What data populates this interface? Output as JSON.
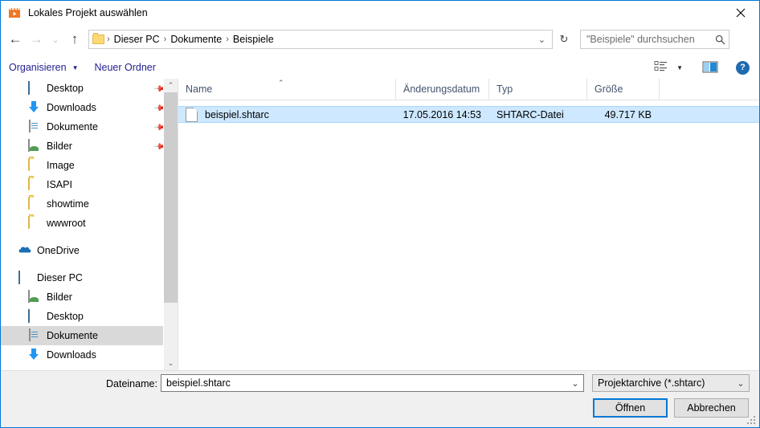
{
  "window": {
    "title": "Lokales Projekt auswählen",
    "icon": "clapperboard-icon",
    "close_label": "✕",
    "accent_color": "#0078d7"
  },
  "nav": {
    "back_label": "←",
    "forward_label": "→",
    "recent_label": "⌄",
    "up_label": "↑",
    "refresh_label": "↻",
    "dropdown_label": "⌄",
    "breadcrumbs": [
      "Dieser PC",
      "Dokumente",
      "Beispiele"
    ],
    "separator": "›"
  },
  "search": {
    "placeholder": "\"Beispiele\" durchsuchen",
    "icon": "search-icon"
  },
  "toolbar": {
    "organize_label": "Organisieren",
    "organize_caret": "▼",
    "new_folder_label": "Neuer Ordner",
    "view_caret": "▼",
    "help_label": "?"
  },
  "sidebar": {
    "quick_access": [
      {
        "label": "Desktop",
        "icon": "monitor-icon",
        "pinned": true,
        "pin": "📌"
      },
      {
        "label": "Downloads",
        "icon": "download-icon",
        "pinned": true,
        "pin": "📌"
      },
      {
        "label": "Dokumente",
        "icon": "document-icon",
        "pinned": true,
        "pin": "📌"
      },
      {
        "label": "Bilder",
        "icon": "pictures-icon",
        "pinned": true,
        "pin": "📌"
      },
      {
        "label": "Image",
        "icon": "folder-icon",
        "pinned": false,
        "pin": ""
      },
      {
        "label": "ISAPI",
        "icon": "folder-icon",
        "pinned": false,
        "pin": ""
      },
      {
        "label": "showtime",
        "icon": "folder-icon",
        "pinned": false,
        "pin": ""
      },
      {
        "label": "wwwroot",
        "icon": "folder-icon",
        "pinned": false,
        "pin": ""
      }
    ],
    "onedrive": {
      "label": "OneDrive",
      "icon": "cloud-icon"
    },
    "this_pc": {
      "label": "Dieser PC",
      "icon": "monitor-icon"
    },
    "this_pc_children": [
      {
        "label": "Bilder",
        "icon": "pictures-icon",
        "selected": false
      },
      {
        "label": "Desktop",
        "icon": "monitor-icon",
        "selected": false
      },
      {
        "label": "Dokumente",
        "icon": "document-icon",
        "selected": true
      },
      {
        "label": "Downloads",
        "icon": "download-icon",
        "selected": false
      }
    ],
    "scroll_up": "⌃",
    "scroll_down": "⌄"
  },
  "file_list": {
    "columns": [
      {
        "key": "name",
        "label": "Name",
        "sorted": true,
        "sort_caret": "⌃"
      },
      {
        "key": "modified",
        "label": "Änderungsdatum",
        "sorted": false,
        "sort_caret": ""
      },
      {
        "key": "type",
        "label": "Typ",
        "sorted": false,
        "sort_caret": ""
      },
      {
        "key": "size",
        "label": "Größe",
        "sorted": false,
        "sort_caret": ""
      }
    ],
    "rows": [
      {
        "name": "beispiel.shtarc",
        "modified": "17.05.2016 14:53",
        "type": "SHTARC-Datei",
        "size": "49.717 KB",
        "icon": "file-icon",
        "selected": true
      }
    ],
    "selection_color": "#cde8ff"
  },
  "footer": {
    "filename_label": "Dateiname:",
    "filename_value": "beispiel.shtarc",
    "filename_placeholder": "",
    "filename_chevron": "⌄",
    "filter_value": "Projektarchive (*.shtarc)",
    "filter_chevron": "⌄",
    "open_label": "Öffnen",
    "cancel_label": "Abbrechen"
  }
}
